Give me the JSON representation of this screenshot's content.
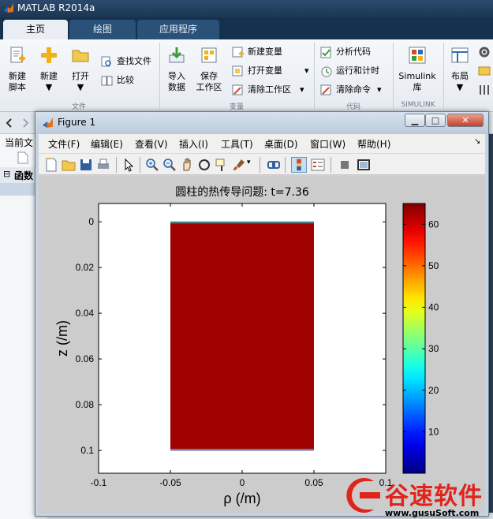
{
  "matlab": {
    "title": "MATLAB R2014a",
    "tabs": [
      "主页",
      "绘图",
      "应用程序"
    ],
    "ribbon": {
      "file_buttons": [
        {
          "line1": "新建",
          "line2": "脚本"
        },
        {
          "line1": "新建",
          "line2": "▼"
        },
        {
          "line1": "打开",
          "line2": "▼"
        }
      ],
      "find_files": "查找文件",
      "compare": "比较",
      "section_file": "文件",
      "import": {
        "line1": "导入",
        "line2": "数据"
      },
      "save_ws": {
        "line1": "保存",
        "line2": "工作区"
      },
      "new_var": "新建变量",
      "open_var": "打开变量",
      "clear_ws": "清除工作区",
      "section_var": "变量",
      "analyze": "分析代码",
      "run_time": "运行和计时",
      "clear_cmd": "清除命令",
      "section_code": "代码",
      "simulink": {
        "line1": "Simulink",
        "line2": "库"
      },
      "section_simulink": "SIMULINK",
      "layout": {
        "line1": "布局",
        "line2": "▼"
      }
    },
    "left_panel": {
      "current_folder": "当前文",
      "functions": "函数"
    }
  },
  "figure": {
    "title": "Figure 1",
    "window_buttons": {
      "minimize": "▁",
      "maximize": "□",
      "close": "✕"
    },
    "menu": [
      "文件(F)",
      "编辑(E)",
      "查看(V)",
      "插入(I)",
      "工具(T)",
      "桌面(D)",
      "窗口(W)",
      "帮助(H)"
    ],
    "toolbar_icons": [
      "new-figure-icon",
      "open-file-icon",
      "save-icon",
      "print-icon",
      "edit-plot-icon",
      "zoom-in-icon",
      "zoom-out-icon",
      "pan-icon",
      "rotate-3d-icon",
      "data-cursor-icon",
      "brush-icon",
      "link-icon",
      "colorbar-icon",
      "legend-icon",
      "hide-plot-tools-icon",
      "show-plot-tools-icon"
    ]
  },
  "chart_data": {
    "type": "heatmap",
    "title": "圆柱的热传导问题: t=7.36",
    "xlabel": "ρ (/m)",
    "ylabel": "z (/m)",
    "xlim": [
      -0.1,
      0.1
    ],
    "ylim": [
      0.11,
      -0.008
    ],
    "y_reversed": true,
    "xticks": [
      -0.1,
      -0.05,
      0,
      0.05,
      0.1
    ],
    "xtick_labels": [
      "-0.1",
      "-0.05",
      "0",
      "0.05",
      "0.1"
    ],
    "yticks": [
      0,
      0.02,
      0.04,
      0.06,
      0.08,
      0.1
    ],
    "ytick_labels": [
      "0",
      "0.02",
      "0.04",
      "0.06",
      "0.08",
      "0.1"
    ],
    "field": {
      "x_range": [
        -0.05,
        0.05
      ],
      "y_range": [
        0,
        0.1
      ],
      "interior_value": 63,
      "boundary_values": [
        0,
        30,
        63
      ]
    },
    "colorbar": {
      "min": 0,
      "max": 65,
      "ticks": [
        10,
        20,
        30,
        40,
        50,
        60
      ],
      "tick_labels": [
        "10",
        "20",
        "30",
        "40",
        "50",
        "60"
      ],
      "colormap": "jet"
    }
  },
  "watermark": {
    "text": "谷速软件",
    "url": "www.gusuSoft.com",
    "color": "#e2231a"
  }
}
